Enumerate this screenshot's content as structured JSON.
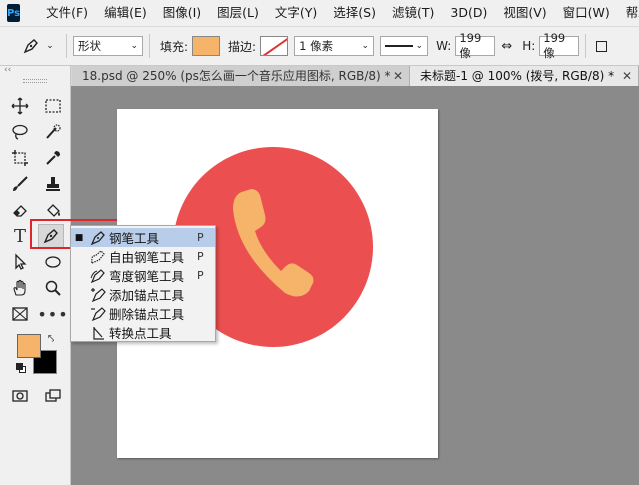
{
  "app": {
    "logo": "Ps"
  },
  "menu": [
    "文件(F)",
    "编辑(E)",
    "图像(I)",
    "图层(L)",
    "文字(Y)",
    "选择(S)",
    "滤镜(T)",
    "3D(D)",
    "视图(V)",
    "窗口(W)",
    "帮助(H)"
  ],
  "options": {
    "mode": "形状",
    "fill_label": "填充:",
    "fill_color": "#f5b46a",
    "stroke_label": "描边:",
    "stroke_width": "1 像素",
    "w_label": "W:",
    "w_value": "199 像",
    "h_label": "H:",
    "h_value": "199 像"
  },
  "tabs": [
    {
      "label": "18.psd @ 250% (ps怎么画一个音乐应用图标, RGB/8) *",
      "active": false
    },
    {
      "label": "未标题-1 @ 100% (拨号, RGB/8) *",
      "active": true
    }
  ],
  "tools_panel": {
    "collapse_glyph": "‹‹",
    "foreground_color": "#f5b46a",
    "background_color": "#000000"
  },
  "canvas": {
    "circle_color": "#ec4f4f",
    "phone_color": "#f5b46a"
  },
  "flyout": {
    "items": [
      {
        "label": "钢笔工具",
        "shortcut": "P",
        "active": true,
        "icon": "pen-icon"
      },
      {
        "label": "自由钢笔工具",
        "shortcut": "P",
        "active": false,
        "icon": "freeform-pen-icon"
      },
      {
        "label": "弯度钢笔工具",
        "shortcut": "P",
        "active": false,
        "icon": "curvature-pen-icon"
      },
      {
        "label": "添加锚点工具",
        "shortcut": "",
        "active": false,
        "icon": "add-anchor-icon"
      },
      {
        "label": "删除锚点工具",
        "shortcut": "",
        "active": false,
        "icon": "delete-anchor-icon"
      },
      {
        "label": "转换点工具",
        "shortcut": "",
        "active": false,
        "icon": "convert-point-icon"
      }
    ]
  }
}
